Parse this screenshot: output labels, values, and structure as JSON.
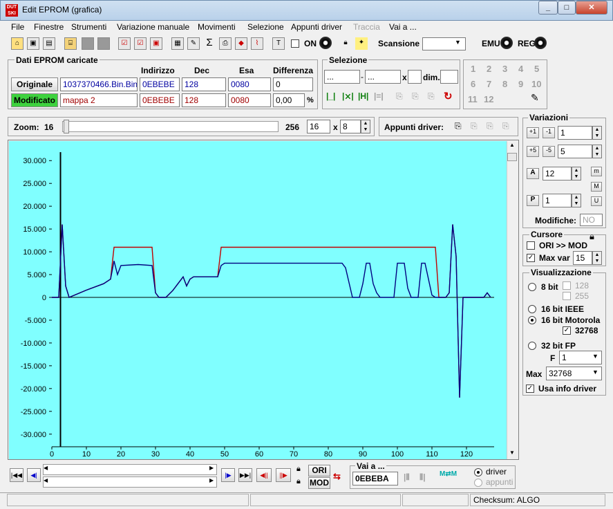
{
  "window": {
    "title": "Edit EPROM (grafica)",
    "icon_text": "DUT SKI"
  },
  "menu": {
    "items": [
      "File",
      "Finestre",
      "Strumenti",
      "Variazione manuale",
      "Movimenti",
      "Selezione",
      "Appunti driver",
      "Traccia",
      "Vai a ..."
    ],
    "disabled": [
      "Traccia"
    ]
  },
  "toolbar": {
    "on_label": "ON",
    "scansione_label": "Scansione",
    "scansione_value": "",
    "emu_label": "EMU",
    "reg_label": "REG"
  },
  "dati": {
    "title": "Dati EPROM caricate",
    "headers": [
      "Indirizzo",
      "Dec",
      "Esa",
      "Differenza"
    ],
    "originale": {
      "label": "Originale",
      "file": "1037370466.Bin.Bin",
      "address": "0EBEBE",
      "dec": "128",
      "hex": "0080",
      "diff": "0"
    },
    "modificato": {
      "label": "Modificato",
      "file": "mappa 2",
      "address": "0EBEBE",
      "dec": "128",
      "hex": "0080",
      "diff": "0,00",
      "percent": "%"
    }
  },
  "selezione": {
    "title": "Selezione",
    "from": "...",
    "to": "...",
    "x_label": "x",
    "dim_label": "dim."
  },
  "numbers": [
    "1",
    "2",
    "3",
    "4",
    "5",
    "6",
    "7",
    "8",
    "9",
    "10",
    "11",
    "12"
  ],
  "zoom": {
    "label": "Zoom:",
    "min": "16",
    "max": "256",
    "value": "16",
    "x_label": "x",
    "factor": "8",
    "appunti_label": "Appunti driver:"
  },
  "variazioni": {
    "title": "Variazioni",
    "v1": "1",
    "v2": "5",
    "v3": "12",
    "v4": "1",
    "modifiche_label": "Modifiche:",
    "modifiche_value": "NO"
  },
  "cursore": {
    "title": "Cursore",
    "ori_mod_label": "ORI >> MOD",
    "ori_mod_checked": false,
    "maxvar_label": "Max var",
    "maxvar_checked": true,
    "maxvar_value": "15"
  },
  "visualizzazione": {
    "title": "Visualizzazione",
    "bit8": "8 bit",
    "v128": "128",
    "v255": "255",
    "ieee": "16 bit IEEE",
    "motorola": "16 bit Motorola",
    "v32768": "32768",
    "fp": "32 bit FP",
    "f_label": "F",
    "f_value": "1",
    "max_label": "Max",
    "max_value": "32768",
    "usa_info": "Usa info driver"
  },
  "bottom": {
    "ori_label": "ORI",
    "mod_label": "MOD",
    "vai_title": "Vai a ...",
    "vai_value": "0EBEBA",
    "driver_label": "driver",
    "appunti_label": "appunti"
  },
  "status": {
    "checksum": "Checksum: ALGO"
  },
  "chart_data": {
    "type": "line",
    "xlim": [
      0,
      128
    ],
    "ylim": [
      -32768,
      32768
    ],
    "x_ticks": [
      0,
      10,
      20,
      30,
      40,
      50,
      60,
      70,
      80,
      90,
      100,
      110,
      120
    ],
    "y_ticks": [
      30000,
      25000,
      20000,
      15000,
      10000,
      5000,
      0,
      -5000,
      -10000,
      -15000,
      -20000,
      -25000,
      -30000
    ],
    "y_tick_labels": [
      "30.000",
      "25.000",
      "20.000",
      "15.000",
      "10.000",
      "5.000",
      "0",
      "-5.000",
      "-10.000",
      "-15.000",
      "-20.000",
      "-25.000",
      "-30.000"
    ],
    "cursor_x": 2.5,
    "grid": false,
    "colors": {
      "background": "#80ffff",
      "original": "#000080",
      "modified": "#c00000",
      "cursor": "#000000"
    },
    "series": [
      {
        "x": [
          0,
          2,
          3,
          4,
          5,
          10,
          15,
          17,
          18,
          19,
          20,
          25,
          29,
          30,
          31,
          33,
          35,
          38,
          39,
          40,
          41,
          48,
          49,
          50,
          80,
          84,
          85,
          87,
          88,
          89,
          90,
          91,
          92,
          93,
          94,
          95,
          96,
          97,
          99,
          100,
          101,
          102,
          103,
          104,
          105,
          106,
          107,
          108,
          110,
          111,
          112,
          113,
          114,
          115,
          116,
          117,
          118,
          119,
          120,
          125,
          126,
          127
        ],
        "y": [
          0,
          0,
          16000,
          2500,
          0,
          1600,
          3000,
          4000,
          8000,
          5000,
          7000,
          7200,
          7000,
          1000,
          0,
          0,
          1500,
          4500,
          2500,
          4000,
          4500,
          4500,
          7000,
          7500,
          7500,
          7500,
          6500,
          0,
          0,
          0,
          3000,
          7500,
          7500,
          3000,
          1000,
          0,
          0,
          0,
          0,
          7500,
          7500,
          7500,
          2000,
          0,
          0,
          0,
          7500,
          7500,
          500,
          0,
          0,
          0,
          0,
          1000,
          16000,
          9000,
          -22000,
          0,
          0,
          0,
          1000,
          0
        ]
      },
      {
        "x": [
          0,
          2,
          3,
          4,
          5,
          10,
          15,
          17,
          18,
          19,
          20,
          25,
          29,
          30,
          31,
          33,
          35,
          38,
          39,
          40,
          41,
          48,
          49,
          50,
          80,
          84,
          85,
          87,
          88,
          89,
          90,
          91,
          92,
          93,
          94,
          95,
          96,
          97,
          99,
          100,
          101,
          102,
          103,
          104,
          105,
          106,
          107,
          108,
          110,
          111,
          112,
          113,
          114,
          115,
          116,
          117,
          118,
          119,
          120,
          125,
          126,
          127
        ],
        "y": [
          0,
          0,
          16000,
          2500,
          0,
          1600,
          3000,
          4000,
          11000,
          11000,
          11000,
          11000,
          11000,
          1000,
          0,
          0,
          1500,
          4500,
          2500,
          4000,
          4500,
          4500,
          11000,
          11000,
          11000,
          11000,
          11000,
          11000,
          11000,
          11000,
          11000,
          11000,
          11000,
          11000,
          11000,
          11000,
          11000,
          11000,
          11000,
          11000,
          11000,
          11000,
          11000,
          11000,
          11000,
          11000,
          11000,
          11000,
          11000,
          11000,
          0,
          0,
          0,
          1000,
          16000,
          9000,
          -22000,
          0,
          0,
          0,
          1000,
          0
        ]
      }
    ]
  }
}
